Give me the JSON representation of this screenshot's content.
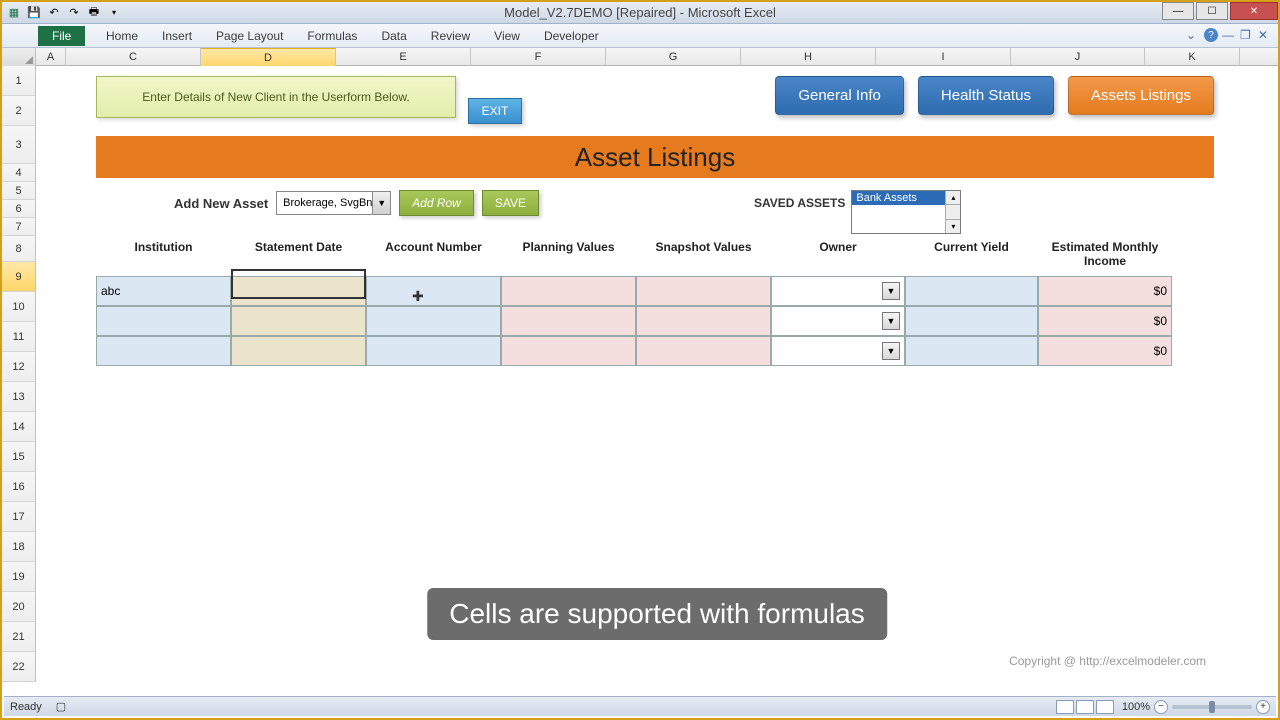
{
  "titlebar": {
    "title": "Model_V2.7DEMO [Repaired] - Microsoft Excel"
  },
  "ribbon": {
    "file": "File",
    "tabs": [
      "Home",
      "Insert",
      "Page Layout",
      "Formulas",
      "Data",
      "Review",
      "View",
      "Developer"
    ]
  },
  "columns": [
    "A",
    "C",
    "D",
    "E",
    "F",
    "G",
    "H",
    "I",
    "J",
    "K"
  ],
  "selected_column": "D",
  "rows": [
    1,
    2,
    3,
    4,
    5,
    6,
    7,
    8,
    9,
    10,
    11,
    12,
    13,
    14,
    15,
    16,
    17,
    18,
    19,
    20,
    21,
    22
  ],
  "selected_row": 9,
  "banner": {
    "text": "Enter Details of New Client in the Userform Below.",
    "exit": "EXIT"
  },
  "nav": {
    "general": "General Info",
    "health": "Health Status",
    "assets": "Assets Listings"
  },
  "page_title": "Asset Listings",
  "add_asset": {
    "label": "Add New Asset",
    "combo_value": "Brokerage, SvgBnds",
    "add_row": "Add Row",
    "save": "SAVE"
  },
  "saved_assets": {
    "label": "SAVED ASSETS",
    "selected": "Bank Assets"
  },
  "table": {
    "headers": {
      "institution": "Institution",
      "statement_date": "Statement Date",
      "account_number": "Account Number",
      "planning_values": "Planning Values",
      "snapshot_values": "Snapshot Values",
      "owner": "Owner",
      "current_yield": "Current Yield",
      "est_income": "Estimated Monthly Income"
    },
    "rows": [
      {
        "institution": "abc",
        "statement_date": "",
        "account_number": "",
        "planning_values": "",
        "snapshot_values": "",
        "owner": "",
        "current_yield": "",
        "est_income": "$0"
      },
      {
        "institution": "",
        "statement_date": "",
        "account_number": "",
        "planning_values": "",
        "snapshot_values": "",
        "owner": "",
        "current_yield": "",
        "est_income": "$0"
      },
      {
        "institution": "",
        "statement_date": "",
        "account_number": "",
        "planning_values": "",
        "snapshot_values": "",
        "owner": "",
        "current_yield": "",
        "est_income": "$0"
      }
    ]
  },
  "caption": "Cells are supported with formulas",
  "copyright": "Copyright @ http://excelmodeler.com",
  "statusbar": {
    "ready": "Ready",
    "zoom": "100%"
  },
  "column_widths": {
    "A": 30,
    "C": 135,
    "D": 135,
    "E": 135,
    "F": 135,
    "G": 135,
    "H": 135,
    "I": 135,
    "J": 134,
    "K": 95
  },
  "table_col_widths": {
    "institution": 135,
    "statement_date": 135,
    "account_number": 135,
    "planning_values": 135,
    "snapshot_values": 135,
    "owner": 134,
    "current_yield": 133,
    "est_income": 134
  }
}
